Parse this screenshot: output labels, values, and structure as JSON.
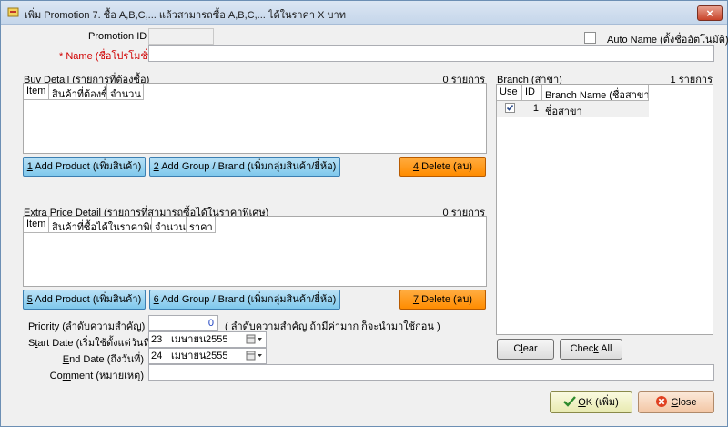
{
  "window": {
    "title": "เพิ่ม Promotion 7. ซื้อ A,B,C,... แล้วสามารถซื้อ A,B,C,... ได้ในราคา X บาท",
    "close_glyph": "×"
  },
  "form": {
    "promotion_id_label": "Promotion ID",
    "promotion_id_value": "",
    "auto_name_label": "Auto Name (ตั้งชื่ออัตโนมัติ)",
    "name_required_mark": "* ",
    "name_label": "Name (ชื่อโปรโมชั่น)",
    "name_value": ""
  },
  "buy_detail": {
    "title_u": "Buy",
    "title_rest": " Detail (รายการที่ต้องซื้อ)",
    "count": "0 รายการ",
    "columns": [
      "Item",
      "สินค้าที่ต้องซื้อ",
      "จำนวน"
    ],
    "add_product_u": "1",
    "add_product_rest": " Add Product (เพิ่มสินค้า)",
    "add_group_u": "2",
    "add_group_rest": " Add Group / Brand (เพิ่มกลุ่มสินค้า/ยี่ห้อ)",
    "delete_u": "4",
    "delete_rest": " Delete (ลบ)"
  },
  "extra_detail": {
    "title_a": "Extra Price De",
    "title_u": "t",
    "title_b": "ail (รายการที่สามารถซื้อได้ในราคาพิเศษ)",
    "count": "0 รายการ",
    "columns": [
      "Item",
      "สินค้าที่ซื้อได้ในราคาพิเศษ",
      "จำนวน",
      "ราคา"
    ],
    "add_product_u": "5",
    "add_product_rest": " Add Product (เพิ่มสินค้า)",
    "add_group_u": "6",
    "add_group_rest": " Add Group / Brand (เพิ่มกลุ่มสินค้า/ยี่ห้อ)",
    "delete_u": "7",
    "delete_rest": " Delete (ลบ)"
  },
  "branch": {
    "title_a": "Branc",
    "title_u": "h",
    "title_b": " (สาขา)",
    "count": "1 รายการ",
    "columns": [
      "Use",
      "ID",
      "Branch Name (ชื่อสาขา)"
    ],
    "rows": [
      {
        "use": true,
        "id": "1",
        "name": "ชื่อสาขา"
      }
    ],
    "clear_a": "C",
    "clear_u": "l",
    "clear_b": "ear",
    "checkall_a": "Chec",
    "checkall_u": "k",
    "checkall_b": " All"
  },
  "settings": {
    "priority_label": "Priority (ลำดับความสำคัญ)",
    "priority_value": "0",
    "priority_hint": "( ลำดับความสำคัญ ถ้ามีค่ามาก ก็จะนำมาใช้ก่อน )",
    "start_label_a": "S",
    "start_label_u": "t",
    "start_label_b": "art Date (เริ่มใช้ตั้งแต่วันที่)",
    "start_day": "23",
    "start_month": "เมษายน",
    "start_year": "2555",
    "end_label_u": "E",
    "end_label_b": "nd Date (ถึงวันที่)",
    "end_day": "24",
    "end_month": "เมษายน",
    "end_year": "2555",
    "comment_label_a": "Co",
    "comment_label_u": "m",
    "comment_label_b": "ment (หมายเหตุ)",
    "comment_value": ""
  },
  "footer": {
    "ok_u": "O",
    "ok_rest": "K (เพิ่ม)",
    "close_u": "C",
    "close_rest": "lose"
  },
  "colors": {
    "blue_button": "#7fc8ec",
    "orange_button": "#ff8c00",
    "required": "#d00000",
    "priority_value": "#1a3fc0"
  }
}
